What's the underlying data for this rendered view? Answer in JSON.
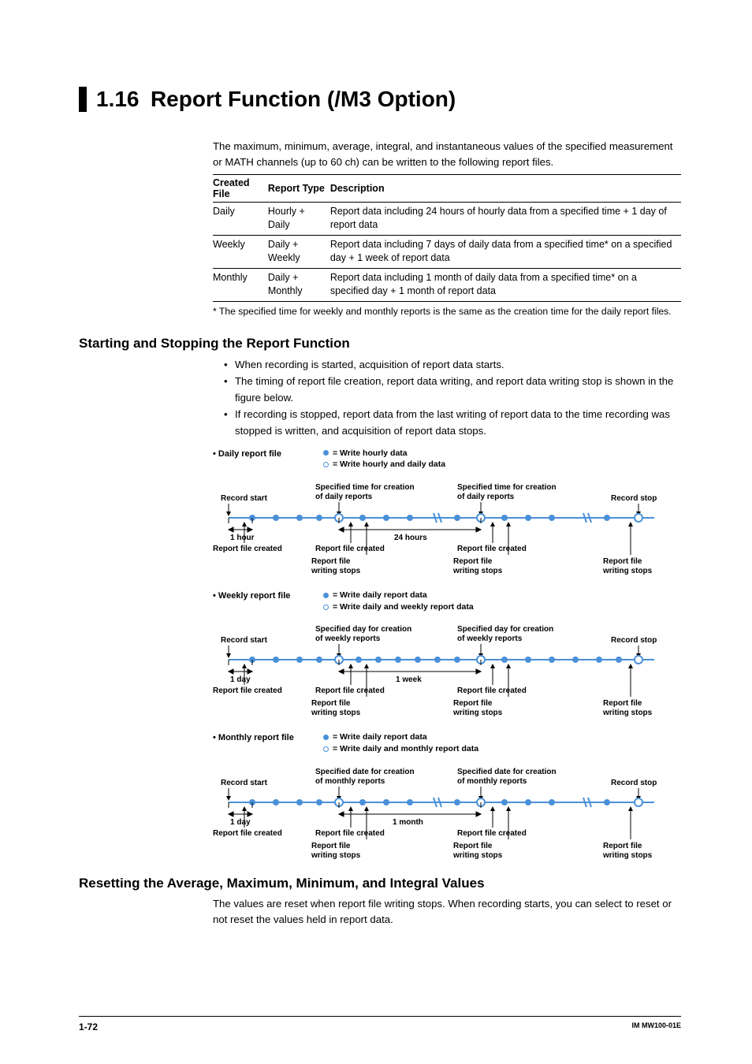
{
  "header": {
    "num": "1.16",
    "title": "Report Function (/M3 Option)"
  },
  "intro": "The maximum, minimum, average, integral, and instantaneous values of the specified measurement or MATH channels (up to 60 ch) can be written to the following report files.",
  "table": {
    "headers": [
      "Created File",
      "Report Type",
      "Description"
    ],
    "rows": [
      [
        "Daily",
        "Hourly + Daily",
        "Report data including 24 hours of hourly data from a specified time + 1 day of report data"
      ],
      [
        "Weekly",
        "Daily + Weekly",
        "Report data including 7 days of daily data from a specified time* on a specified day + 1 week of report data"
      ],
      [
        "Monthly",
        "Daily + Monthly",
        "Report data including 1 month of daily data from a specified time* on a specified day + 1 month of report data"
      ]
    ]
  },
  "footnote": "* The specified time for weekly and monthly reports is the same as the creation time for the daily report files.",
  "sub1": {
    "heading": "Starting and Stopping the Report Function",
    "bullets": [
      "When recording is started, acquisition of report data starts.",
      "The timing of report file creation, report data writing, and report data writing stop is shown in the figure below.",
      "If recording is stopped, report data from the last writing of report data to the time recording was stopped is written, and acquisition of report data stops."
    ]
  },
  "diagrams": {
    "daily": {
      "title": "• Daily report file",
      "legend1": "= Write hourly data",
      "legend2": "= Write hourly and daily data",
      "spec_label": "Specified time for creation of daily reports",
      "interval_short": "1 hour",
      "interval_long": "24 hours"
    },
    "weekly": {
      "title": "• Weekly report file",
      "legend1": "= Write daily report data",
      "legend2": "= Write daily and weekly report data",
      "spec_label": "Specified day for creation of weekly reports",
      "interval_short": "1 day",
      "interval_long": "1 week"
    },
    "monthly": {
      "title": "• Monthly report file",
      "legend1": "= Write daily report data",
      "legend2": "= Write daily and monthly report data",
      "spec_label": "Specified date for creation of monthly reports",
      "interval_short": "1 day",
      "interval_long": "1 month"
    },
    "common": {
      "record_start": "Record start",
      "record_stop": "Record stop",
      "file_created": "Report file created",
      "writing_stops": "Report file writing stops"
    }
  },
  "sub2": {
    "heading": "Resetting the Average, Maximum, Minimum, and Integral Values",
    "body": "The values are reset when report file writing stops. When recording starts, you can select to reset or not reset the values held in report data."
  },
  "footer": {
    "page": "1-72",
    "doc": "IM MW100-01E"
  }
}
